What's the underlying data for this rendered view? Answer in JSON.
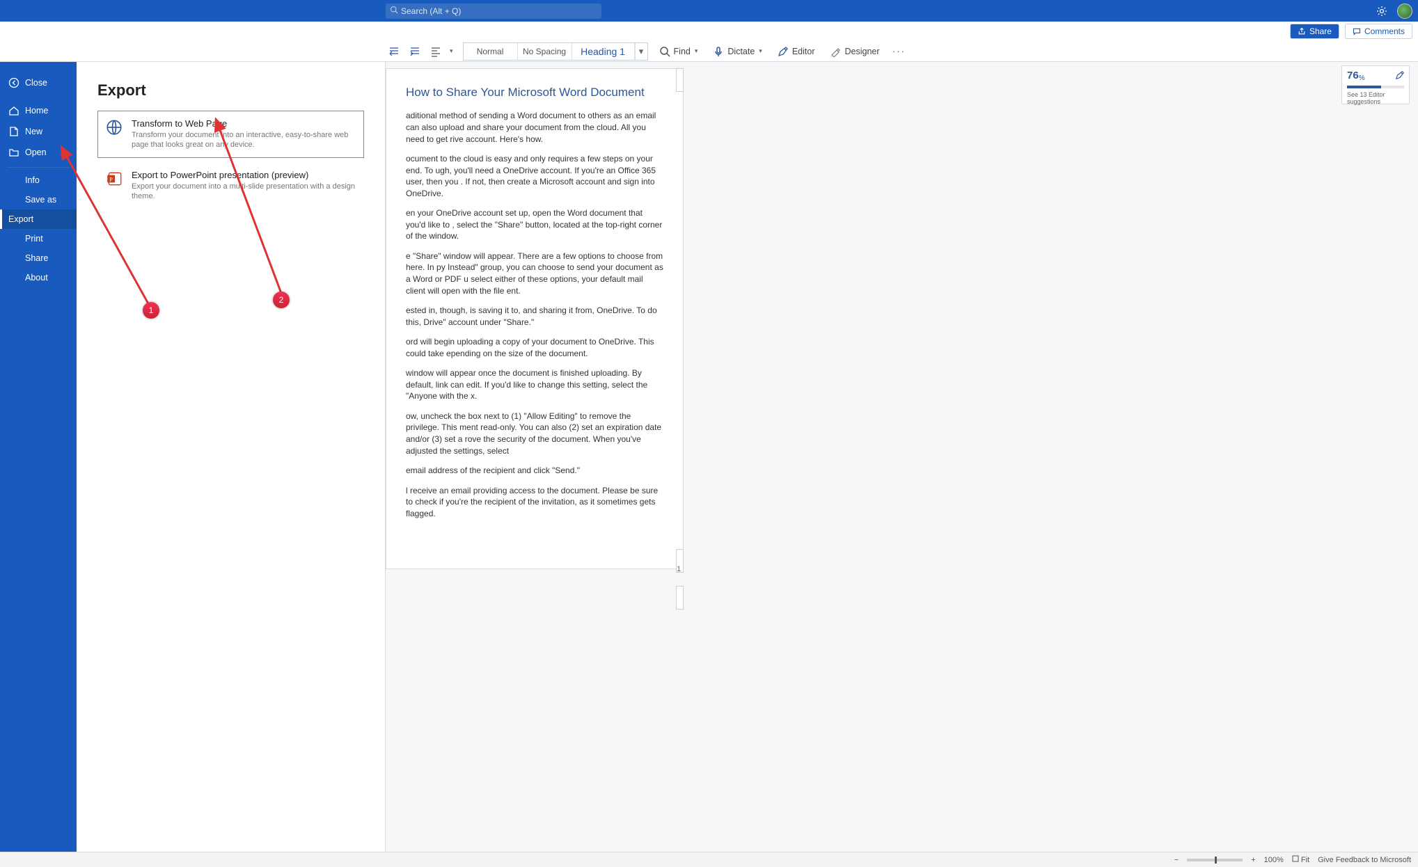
{
  "titlebar": {
    "search_placeholder": "Search (Alt + Q)"
  },
  "secondbar": {
    "share": "Share",
    "comments": "Comments"
  },
  "ribbon": {
    "styles": {
      "normal": "Normal",
      "nospacing": "No Spacing",
      "heading1": "Heading 1"
    },
    "find": "Find",
    "dictate": "Dictate",
    "editor": "Editor",
    "designer": "Designer"
  },
  "editor_widget": {
    "score": "76",
    "pct": "%",
    "suggestions": "See 13 Editor suggestions"
  },
  "statusbar": {
    "zoom": "100%",
    "fit": "Fit",
    "feedback": "Give Feedback to Microsoft"
  },
  "backstage": {
    "close": "Close",
    "home": "Home",
    "new": "New",
    "open": "Open",
    "info": "Info",
    "saveas": "Save as",
    "export": "Export",
    "print": "Print",
    "share": "Share",
    "about": "About",
    "panel_title": "Export",
    "opt1_title": "Transform to Web Page",
    "opt1_desc": "Transform your document into an interactive, easy-to-share web page that looks great on any device.",
    "opt2_title": "Export to PowerPoint presentation (preview)",
    "opt2_desc": "Export your document into a multi-slide presentation with a design theme."
  },
  "doc": {
    "title": "How to Share Your Microsoft Word Document",
    "p1": "aditional method of sending a Word document to others as an email can also upload and share your document from the cloud. All you need to get rive account. Here's how.",
    "p2": "ocument to the cloud is easy and only requires a few steps on your end. To ugh, you'll need a OneDrive account. If you're an Office 365 user, then you . If not, then create a Microsoft account and sign into OneDrive.",
    "p3": "en your OneDrive account set up, open the Word document that you'd like to , select the \"Share\" button, located at the top-right corner of the window.",
    "p4": "e \"Share\" window will appear. There are a few options to choose from here. In py Instead\" group, you can choose to send your document as a Word or PDF u select either of these options, your default mail client will open with the file ent.",
    "p5": "ested in, though, is saving it to, and sharing it from, OneDrive. To do this, Drive\" account under \"Share.\"",
    "p6": "ord will begin uploading a copy of your document to OneDrive. This could take epending on the size of the document.",
    "p7": "window will appear once the document is finished uploading. By default, link can edit. If you'd like to change this setting, select the \"Anyone with the x.",
    "p8": "ow, uncheck the box next to (1) \"Allow Editing\" to remove the privilege. This ment read-only. You can also (2) set an expiration date and/or (3) set a rove the security of the document. When you've adjusted the settings, select",
    "p9": "email address of the recipient and click \"Send.\"",
    "p10": "l receive an email providing access to the document. Please be sure to check if you're the recipient of the invitation, as it sometimes gets flagged.",
    "page_number": "1"
  },
  "annotations": {
    "b1": "1",
    "b2": "2"
  }
}
